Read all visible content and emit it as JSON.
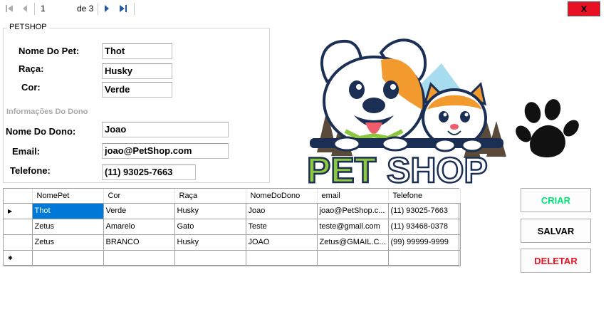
{
  "navigator": {
    "position": "1",
    "count": "de 3"
  },
  "window": {
    "close_label": "X"
  },
  "group": {
    "title": "PETSHOP"
  },
  "pet": {
    "name_label": "Nome Do  Pet:",
    "name_value": "Thot",
    "breed_label": "Raça:",
    "breed_value": "Husky",
    "color_label": "Cor:",
    "color_value": "Verde"
  },
  "owner": {
    "section_label": "Informações Do Dono",
    "name_label": "Nome Do Dono:",
    "name_value": "Joao",
    "email_label": "Email:",
    "email_value": "joao@PetShop.com",
    "phone_label": "Telefone:",
    "phone_value": "(11) 93025-7663"
  },
  "logo": {
    "brand_part1": "PET",
    "brand_part2": "SHOP"
  },
  "grid": {
    "columns": [
      "NomePet",
      "Cor",
      "Raça",
      "NomeDoDono",
      "email",
      "Telefone"
    ],
    "rows": [
      [
        "Thot",
        "Verde",
        "Husky",
        "Joao",
        "joao@PetShop.c...",
        "(11) 93025-7663"
      ],
      [
        "Zetus",
        "Amarelo",
        "Gato",
        "Teste",
        "teste@gmail.com",
        "(11) 93468-0378"
      ],
      [
        "Zetus",
        "BRANCO",
        "Husky",
        "JOAO",
        "Zetus@GMAIL.C...",
        "(99) 99999-9999"
      ]
    ],
    "current_row_glyph": "▶",
    "new_row_glyph": "✱"
  },
  "actions": {
    "create_label": "CRIAR",
    "save_label": "SALVAR",
    "delete_label": "DELETAR"
  },
  "colors": {
    "create": "#00e676",
    "delete": "#e81123",
    "selection": "#0078d7",
    "close": "#e81123",
    "logo_green": "#8dc63f",
    "logo_navy": "#1b2f55",
    "logo_orange": "#f29a2e"
  },
  "icons": [
    "first-record-icon",
    "previous-record-icon",
    "next-record-icon",
    "last-record-icon",
    "paw-icon"
  ]
}
